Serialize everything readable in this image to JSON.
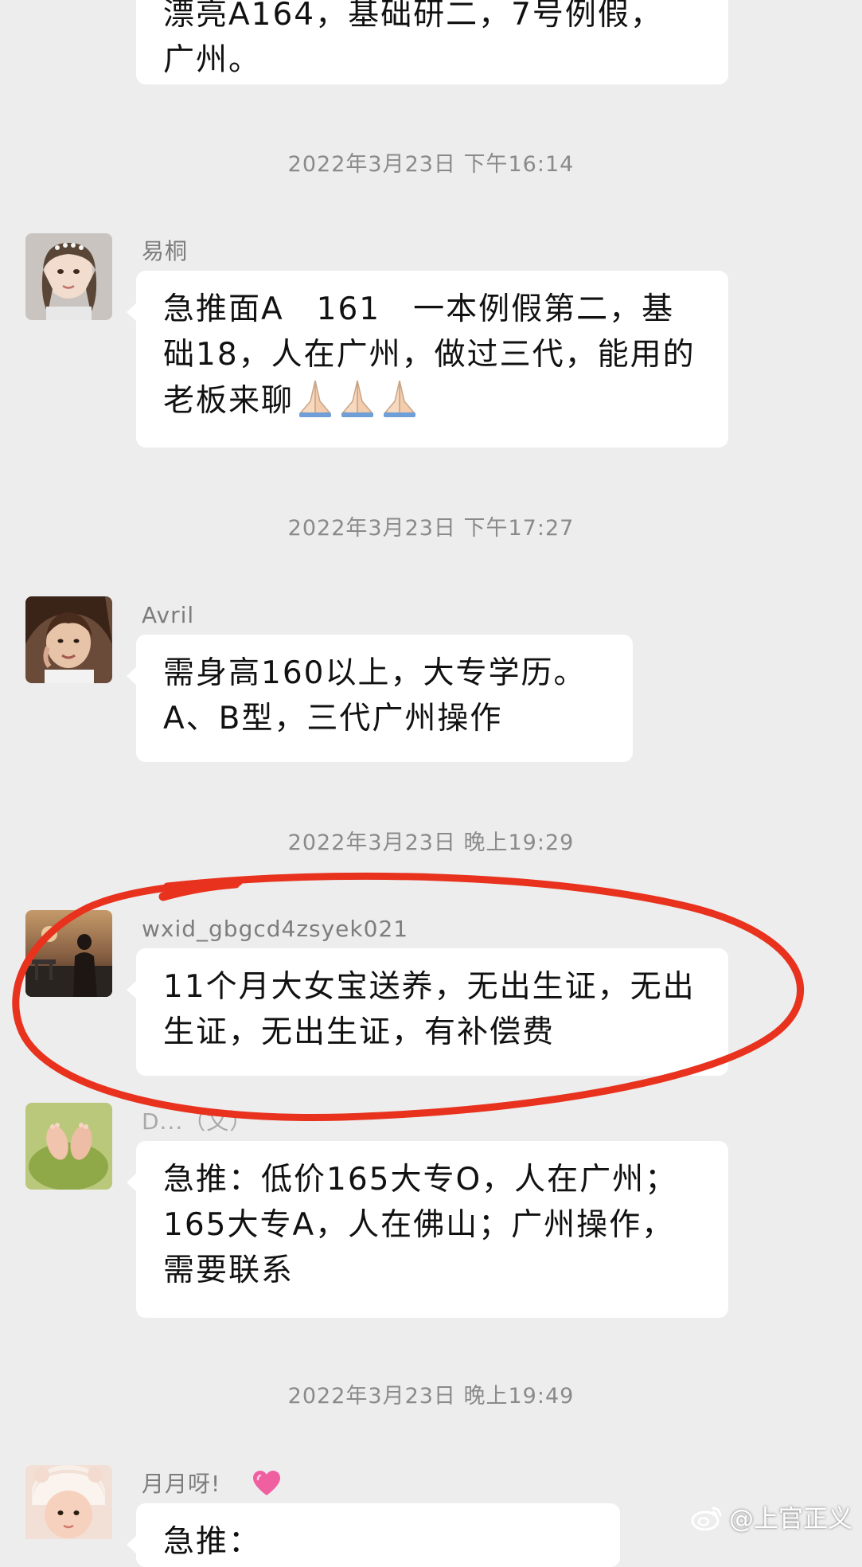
{
  "messages": [
    {
      "text_line1": "漂亮A164，基础研二，7号例假，",
      "text_line2": "广州。"
    },
    {
      "timestamp": "2022年3月23日 下午16:14",
      "sender": "易桐",
      "avatar_icon": "girl-portrait-avatar",
      "text": "急推面A　161　一本例假第二，基础18，人在广州，做过三代，能用的老板来聊",
      "emoji": "folded-hands-icon"
    },
    {
      "timestamp": "2022年3月23日 下午17:27",
      "sender": "Avril",
      "avatar_icon": "person-photo-avatar",
      "line1": "需身高160以上，大专学历。",
      "line2": "A、B型，三代广州操作"
    },
    {
      "timestamp": "2022年3月23日 晚上19:29",
      "sender": "wxid_gbgcd4zsyek021",
      "avatar_icon": "sunset-silhouette-avatar",
      "text": "11个月大女宝送养，无出生证，无出生证，无出生证，有补偿费",
      "highlighted": true,
      "highlight_color": "#e8321e"
    },
    {
      "sender": "D...（文）",
      "avatar_icon": "baby-feet-avatar",
      "text": "急推：低价165大专O，人在广州；165大专A，人在佛山；广州操作，需要联系"
    },
    {
      "timestamp": "2022年3月23日 晚上19:49",
      "sender": "月月呀!",
      "sender_emoji": "pink-heart-icon",
      "avatar_icon": "baby-hat-avatar",
      "text": "急推："
    }
  ],
  "watermark": {
    "text": "@上官正义",
    "icon": "weibo-icon"
  },
  "colors": {
    "background": "#ededed",
    "bubble": "#ffffff",
    "timestamp": "#8a8a8a",
    "sender": "#7d7d7d",
    "annotation": "#e8321e"
  }
}
